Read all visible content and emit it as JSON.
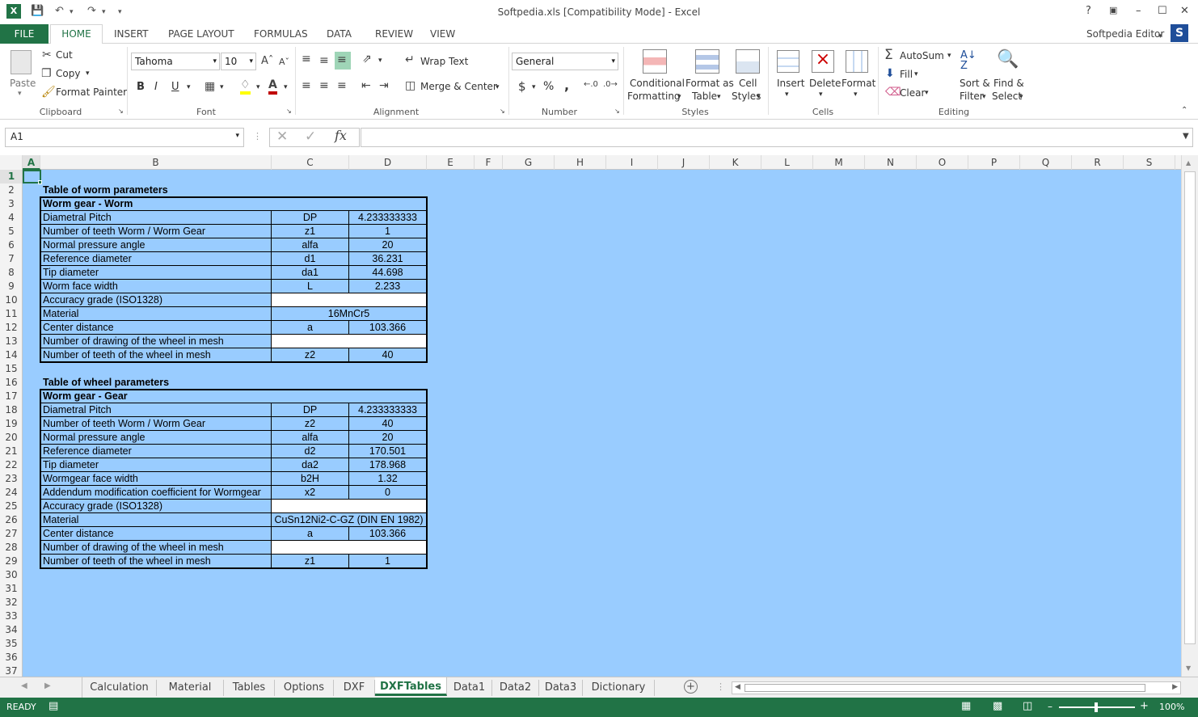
{
  "window": {
    "title": "Softpedia.xls  [Compatibility Mode] - Excel",
    "help": "?",
    "user": "Softpedia Editor",
    "user_initial": "S"
  },
  "ribbon_tabs": [
    "FILE",
    "HOME",
    "INSERT",
    "PAGE LAYOUT",
    "FORMULAS",
    "DATA",
    "REVIEW",
    "VIEW"
  ],
  "clipboard": {
    "paste": "Paste",
    "cut": "Cut",
    "copy": "Copy",
    "format_painter": "Format Painter",
    "group": "Clipboard"
  },
  "font": {
    "name": "Tahoma",
    "size": "10",
    "bold": "B",
    "italic": "I",
    "underline": "U",
    "group": "Font"
  },
  "alignment": {
    "wrap_text": "Wrap Text",
    "merge_center": "Merge & Center",
    "group": "Alignment"
  },
  "number": {
    "format": "General",
    "currency": "$",
    "percent": "%",
    "comma": ",",
    "group": "Number"
  },
  "styles": {
    "conditional": [
      "Conditional",
      "Formatting"
    ],
    "format_table": [
      "Format as",
      "Table"
    ],
    "cell_styles": [
      "Cell",
      "Styles"
    ],
    "group": "Styles"
  },
  "cells": {
    "insert": "Insert",
    "delete": "Delete",
    "format": "Format",
    "group": "Cells"
  },
  "editing": {
    "autosum": "AutoSum",
    "fill": "Fill",
    "clear": "Clear",
    "sort": [
      "Sort &",
      "Filter"
    ],
    "find": [
      "Find &",
      "Select"
    ],
    "group": "Editing"
  },
  "formula_bar": {
    "name_box": "A1",
    "fx": "fx",
    "formula": ""
  },
  "columns": [
    "A",
    "B",
    "C",
    "D",
    "E",
    "F",
    "G",
    "H",
    "I",
    "J",
    "K",
    "L",
    "M",
    "N",
    "O",
    "P",
    "Q",
    "R",
    "S"
  ],
  "rows": [
    "1",
    "2",
    "3",
    "4",
    "5",
    "6",
    "7",
    "8",
    "9",
    "10",
    "11",
    "12",
    "13",
    "14",
    "15",
    "16",
    "17",
    "18",
    "19",
    "20",
    "21",
    "22",
    "23",
    "24",
    "25",
    "26",
    "27",
    "28",
    "29",
    "30",
    "31",
    "32",
    "33",
    "34",
    "35",
    "36",
    "37"
  ],
  "worm_table": {
    "title": "Table of worm parameters",
    "header": "Worm gear - Worm",
    "rows": [
      [
        "Diametral Pitch",
        "DP",
        "4.233333333"
      ],
      [
        "Number of teeth Worm /  Worm Gear",
        "z1",
        "1"
      ],
      [
        "Normal pressure angle",
        "alfa",
        "20"
      ],
      [
        "Reference diameter",
        "d1",
        "36.231"
      ],
      [
        "Tip diameter",
        "da1",
        "44.698"
      ],
      [
        "Worm face width",
        "L",
        "2.233"
      ],
      [
        "Accuracy grade (ISO1328)",
        "",
        ""
      ],
      [
        "Material",
        "16MnCr5",
        ""
      ],
      [
        "Center distance",
        "a",
        "103.366"
      ],
      [
        "Number of drawing of the wheel in mesh",
        "",
        ""
      ],
      [
        "Number of teeth of the wheel in mesh",
        "z2",
        "40"
      ]
    ]
  },
  "wheel_table": {
    "title": "Table of wheel parameters",
    "header": "Worm gear - Gear",
    "rows": [
      [
        "Diametral Pitch",
        "DP",
        "4.233333333"
      ],
      [
        "Number of teeth Worm /  Worm Gear",
        "z2",
        "40"
      ],
      [
        "Normal pressure angle",
        "alfa",
        "20"
      ],
      [
        "Reference diameter",
        "d2",
        "170.501"
      ],
      [
        "Tip diameter",
        "da2",
        "178.968"
      ],
      [
        "Wormgear face width",
        "b2H",
        "1.32"
      ],
      [
        "Addendum modification coefficient for Wormgear",
        "x2",
        "0"
      ],
      [
        "Accuracy grade (ISO1328)",
        "",
        ""
      ],
      [
        "Material",
        "CuSn12Ni2-C-GZ (DIN EN 1982)",
        ""
      ],
      [
        "Center distance",
        "a",
        "103.366"
      ],
      [
        "Number of drawing of the wheel in mesh",
        "",
        ""
      ],
      [
        "Number of teeth of the wheel in mesh",
        "z1",
        "1"
      ]
    ]
  },
  "sheet_tabs": [
    "Calculation",
    "Material",
    "Tables",
    "Options",
    "DXF",
    "DXFTables",
    "Data1",
    "Data2",
    "Data3",
    "Dictionary"
  ],
  "active_sheet": "DXFTables",
  "status": {
    "mode": "READY",
    "zoom": "100%"
  },
  "colors": {
    "excel_green": "#217346",
    "sheet_fill": "#99ccff"
  }
}
